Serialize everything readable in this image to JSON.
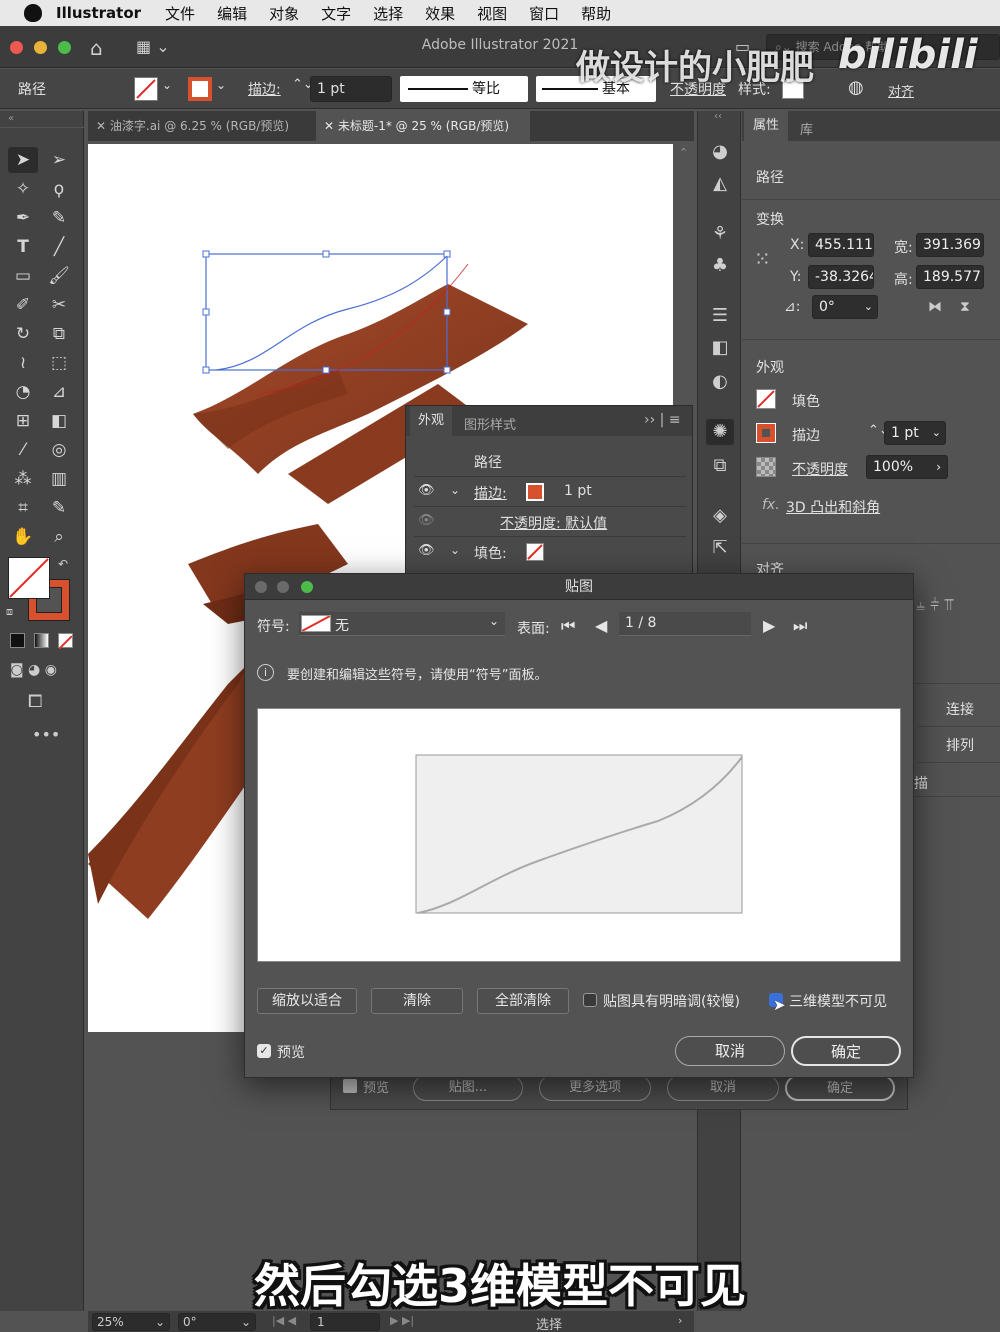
{
  "menubar": {
    "app": "Illustrator",
    "items": [
      "文件",
      "编辑",
      "对象",
      "文字",
      "选择",
      "效果",
      "视图",
      "窗口",
      "帮助"
    ]
  },
  "window": {
    "title": "Adobe Illustrator 2021",
    "search_placeholder": "搜索 Adobe 帮助"
  },
  "control_bar": {
    "object_label": "路径",
    "stroke_label": "描边:",
    "stroke_value": "1 pt",
    "profile_label": "等比",
    "brush_label": "基本",
    "opacity_label": "不透明度",
    "style_label": "样式:",
    "align_label": "对齐"
  },
  "tabs": [
    {
      "label": "油漆字.ai @ 6.25 % (RGB/预览)"
    },
    {
      "label": "未标题-1* @ 25 % (RGB/预览)"
    }
  ],
  "properties": {
    "tab_properties": "属性",
    "tab_library": "库",
    "object_type": "路径",
    "transform_title": "变换",
    "x_label": "X:",
    "x_value": "455.111",
    "y_label": "Y:",
    "y_value": "-38.3264",
    "w_label": "宽:",
    "w_value": "391.369",
    "h_label": "高:",
    "h_value": "189.577",
    "angle_label": "⊿:",
    "angle_value": "0°",
    "appearance_title": "外观",
    "fill_label": "填色",
    "stroke_label": "描边",
    "stroke_value": "1 pt",
    "opacity_label": "不透明度",
    "opacity_value": "100%",
    "effect_label": "3D 凸出和斜角",
    "align_title": "对齐",
    "connect_label": "连接",
    "arrange_label": "排列",
    "partial_label": "描"
  },
  "appearance_panel": {
    "tab_appearance": "外观",
    "tab_graphic_styles": "图形样式",
    "row_path": "路径",
    "row_stroke_label": "描边:",
    "row_stroke_value": "1 pt",
    "row_opacity": "不透明度: 默认值",
    "row_fill_label": "填色:"
  },
  "behind_panel": {
    "preview_label": "预览",
    "map_art": "贴图...",
    "more_options": "更多选项",
    "cancel": "取消",
    "ok": "确定"
  },
  "dialog": {
    "title": "贴图",
    "symbol_label": "符号:",
    "symbol_value": "无",
    "surface_label": "表面:",
    "surface_value": "1 / 8",
    "info_text": "要创建和编辑这些符号，请使用“符号”面板。",
    "scale_to_fit": "缩放以适合",
    "clear": "清除",
    "clear_all": "全部清除",
    "shade_artwork": "贴图具有明暗调(较慢)",
    "invisible_geometry": "三维模型不可见",
    "preview": "预览",
    "cancel": "取消",
    "ok": "确定"
  },
  "statusbar": {
    "zoom": "25%",
    "rotation": "0°",
    "artboard_num": "1",
    "tool_name": "选择"
  },
  "overlay": {
    "watermark": "做设计的小肥肥",
    "bilibili": "bilibili",
    "subtitle": "然后勾选3维模型不可见"
  },
  "colors": {
    "accent_orange": "#d8512f",
    "ribbon": "#8e3d20",
    "selection_blue": "#4a6fd0"
  }
}
